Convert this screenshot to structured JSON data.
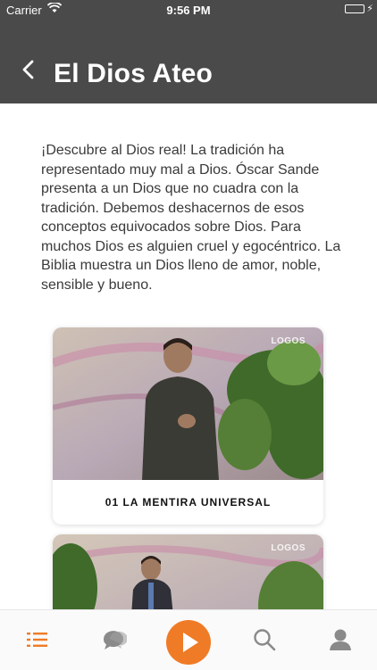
{
  "status_bar": {
    "carrier": "Carrier",
    "time": "9:56 PM"
  },
  "header": {
    "title": "El Dios Ateo"
  },
  "description": "¡Descubre al Dios real! La tradición ha representado muy mal a Dios. Óscar Sande presenta a un Dios que no cuadra con la tradición. Debemos deshacernos de esos conceptos equivocados sobre Dios. Para muchos Dios es alguien cruel y egocéntrico. La Biblia muestra un Dios lleno de amor, noble, sensible y bueno.",
  "episodes": [
    {
      "title": "01 LA MENTIRA UNIVERSAL",
      "watermark": "LOGOS"
    },
    {
      "title": "",
      "watermark": "LOGOS"
    }
  ],
  "tabbar": {
    "items": [
      "list-icon",
      "chat-icon",
      "play-icon",
      "search-icon",
      "profile-icon"
    ],
    "accent": "#f07b26",
    "inactive": "#8a8a8a"
  },
  "colors": {
    "header_bg": "#4a4a4a",
    "accent": "#f07b26"
  }
}
